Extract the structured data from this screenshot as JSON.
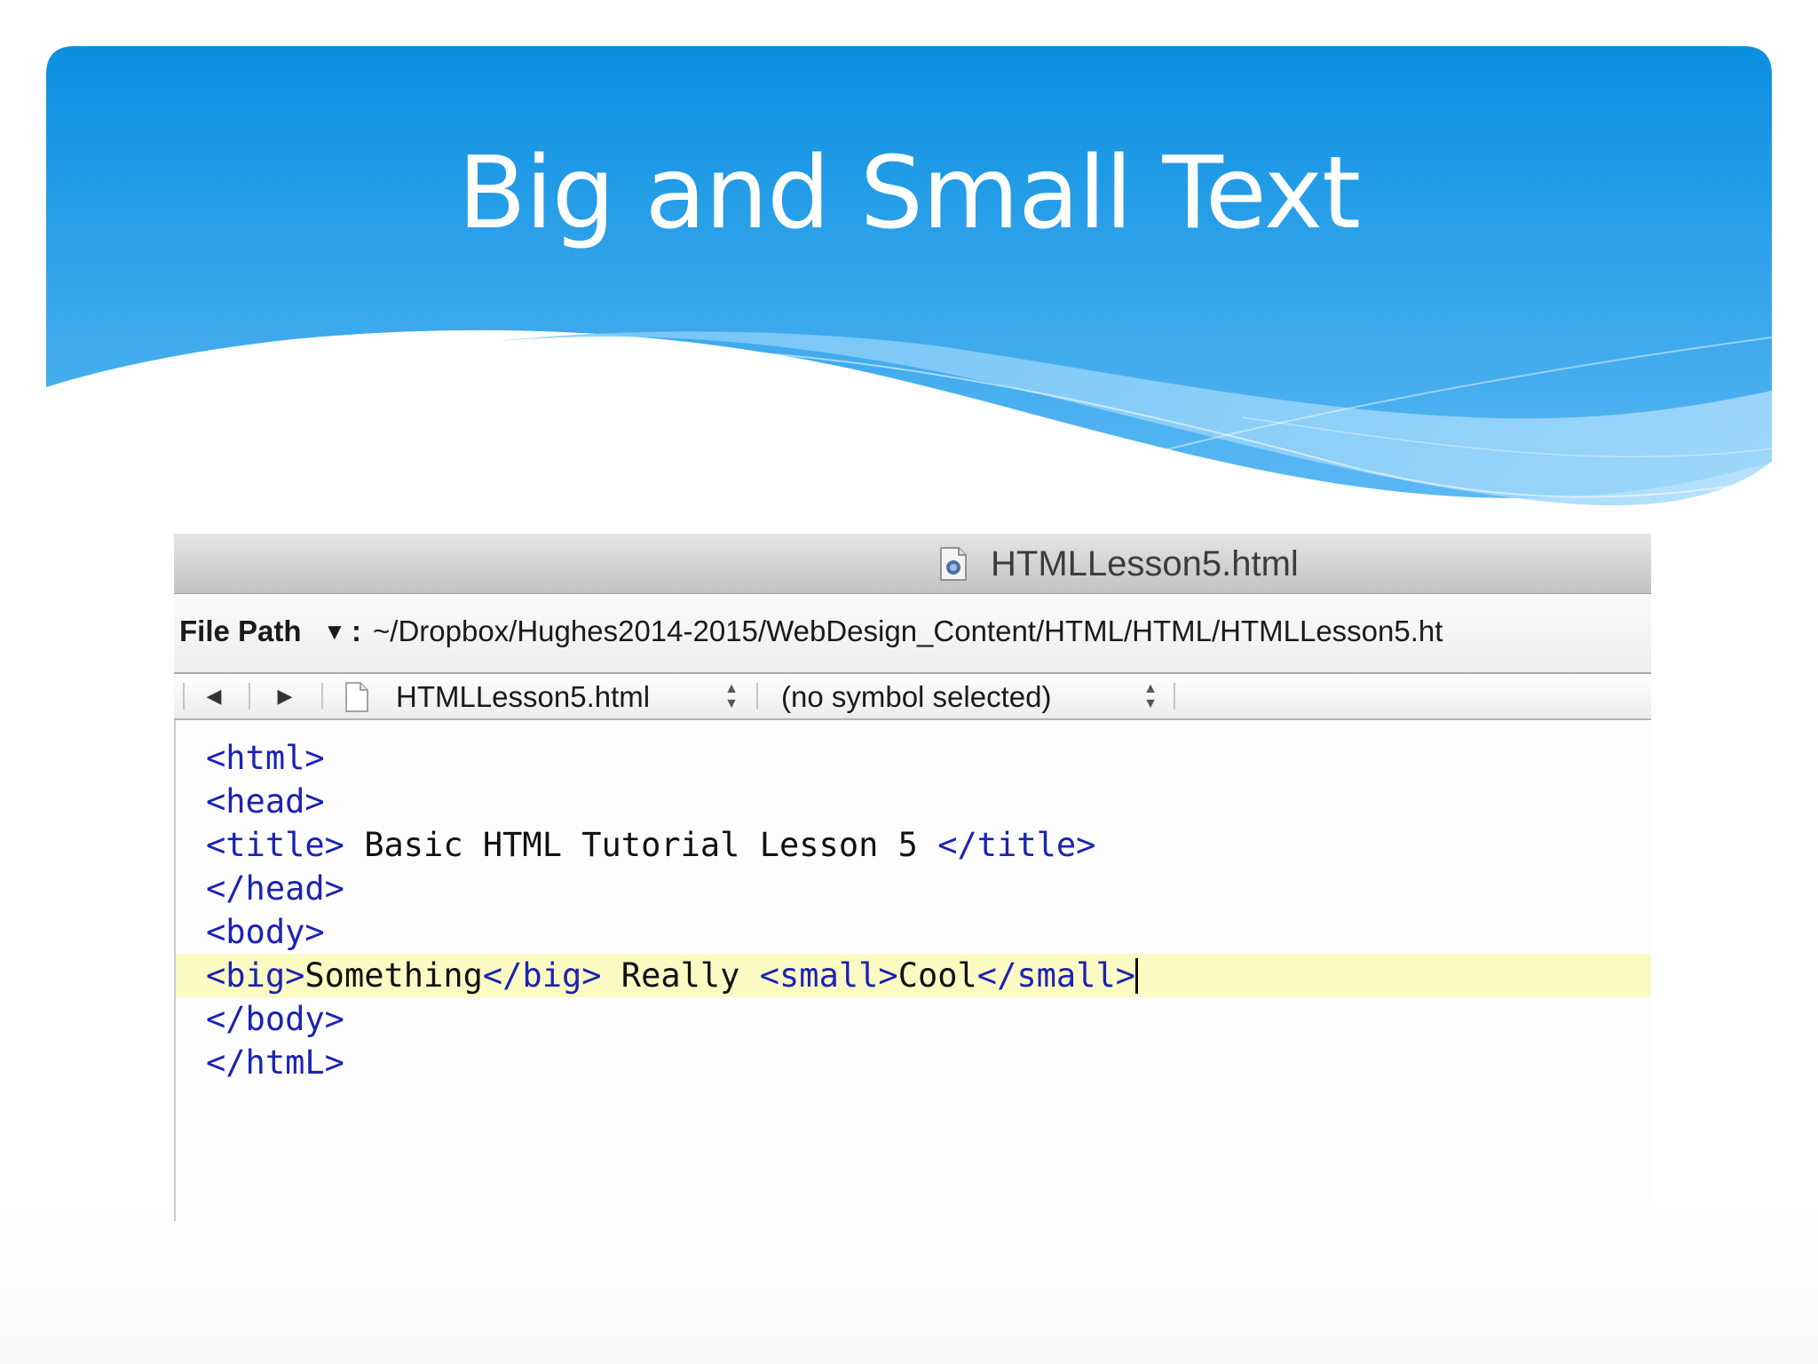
{
  "slide": {
    "title": "Big and Small Text"
  },
  "editor": {
    "window_title": "HTMLLesson5.html",
    "path_label": "File Path",
    "path_colon": ":",
    "path_value": "~/Dropbox/Hughes2014-2015/WebDesign_Content/HTML/HTML/HTMLLesson5.ht",
    "file_popup": "HTMLLesson5.html",
    "symbol_popup": "(no symbol selected)",
    "code": {
      "l1": "<html>",
      "l2": "<head>",
      "l3_open": "<title>",
      "l3_text": " Basic HTML Tutorial Lesson 5 ",
      "l3_close": "</title>",
      "l4": "</head>",
      "l5": "<body>",
      "l6_big_open": "<big>",
      "l6_big_text": "Something",
      "l6_big_close": "</big>",
      "l6_mid": " Really ",
      "l6_small_open": "<small>",
      "l6_small_text": "Cool",
      "l6_small_close": "</small>",
      "l7": "</body>",
      "l8": "</htmL>"
    }
  },
  "colors": {
    "banner_top": "#0a8fe0",
    "banner_bottom": "#5ab8f4",
    "tag": "#1b22b4",
    "current_line": "#fbfac2"
  }
}
